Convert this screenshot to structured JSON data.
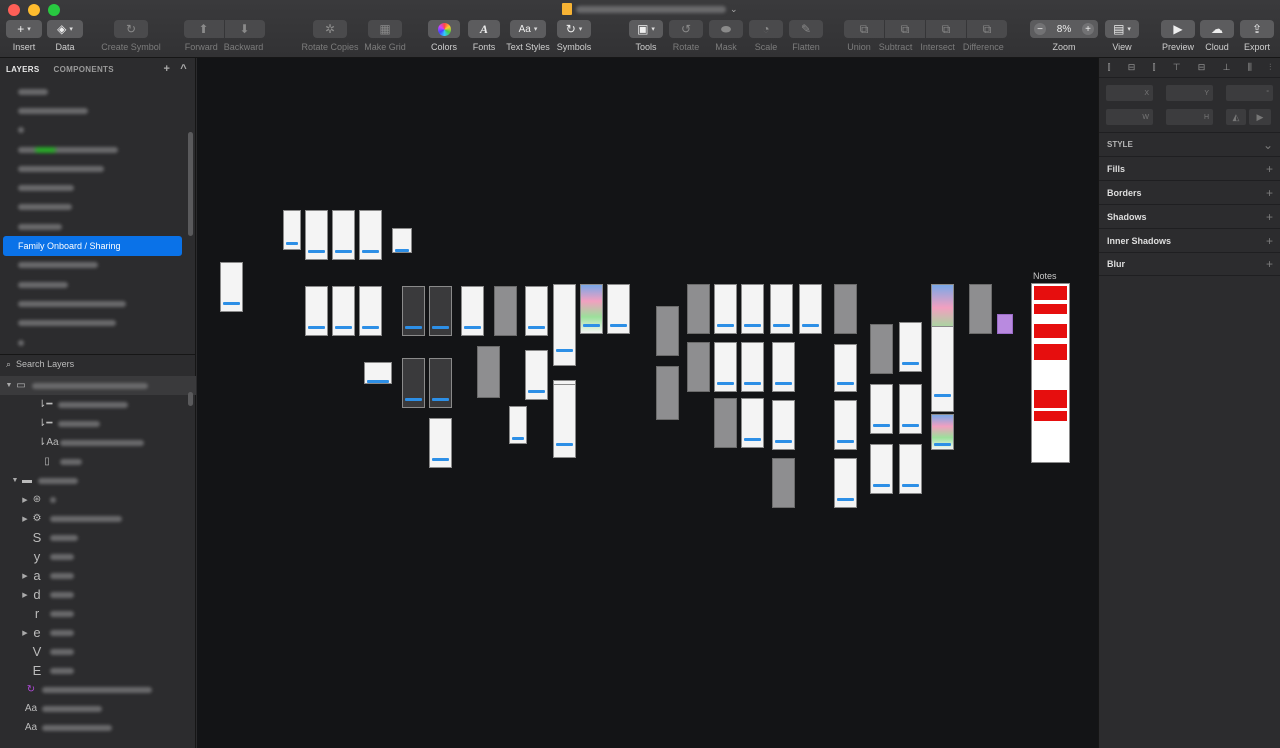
{
  "toolbar": {
    "insert": "Insert",
    "data": "Data",
    "create_symbol": "Create Symbol",
    "forward": "Forward",
    "backward": "Backward",
    "rotate_copies": "Rotate Copies",
    "make_grid": "Make Grid",
    "colors": "Colors",
    "fonts": "Fonts",
    "text_styles": "Text Styles",
    "text_styles_glyph": "Aa",
    "symbols": "Symbols",
    "tools": "Tools",
    "rotate": "Rotate",
    "mask": "Mask",
    "scale": "Scale",
    "flatten": "Flatten",
    "union": "Union",
    "subtract": "Subtract",
    "intersect": "Intersect",
    "difference": "Difference",
    "zoom_label": "Zoom",
    "zoom_value": "8%",
    "zoom_minus": "−",
    "zoom_plus": "+",
    "view": "View",
    "preview": "Preview",
    "cloud": "Cloud",
    "export": "Export"
  },
  "left_panel": {
    "tab_layers": "LAYERS",
    "tab_components": "COMPONENTS",
    "add": "+",
    "collapse": "^",
    "selected_page": "Family Onboard / Sharing",
    "search_placeholder": "Search Layers",
    "layer_glyphs": [
      "Aa",
      "S",
      "y",
      "a",
      "d",
      "r",
      "e",
      "V",
      "E",
      "Aa",
      "Aa"
    ]
  },
  "canvas": {
    "notes_label": "Notes"
  },
  "inspector": {
    "x": "X",
    "y": "Y",
    "w": "W",
    "h": "H",
    "style": "STYLE",
    "fills": "Fills",
    "borders": "Borders",
    "shadows": "Shadows",
    "inner_shadows": "Inner Shadows",
    "blur": "Blur",
    "plus": "+"
  },
  "colors": {
    "accent": "#0a72e8",
    "canvas_bg": "#131416",
    "panel_bg": "#2c2c2e",
    "note_red": "#e60e0e"
  }
}
